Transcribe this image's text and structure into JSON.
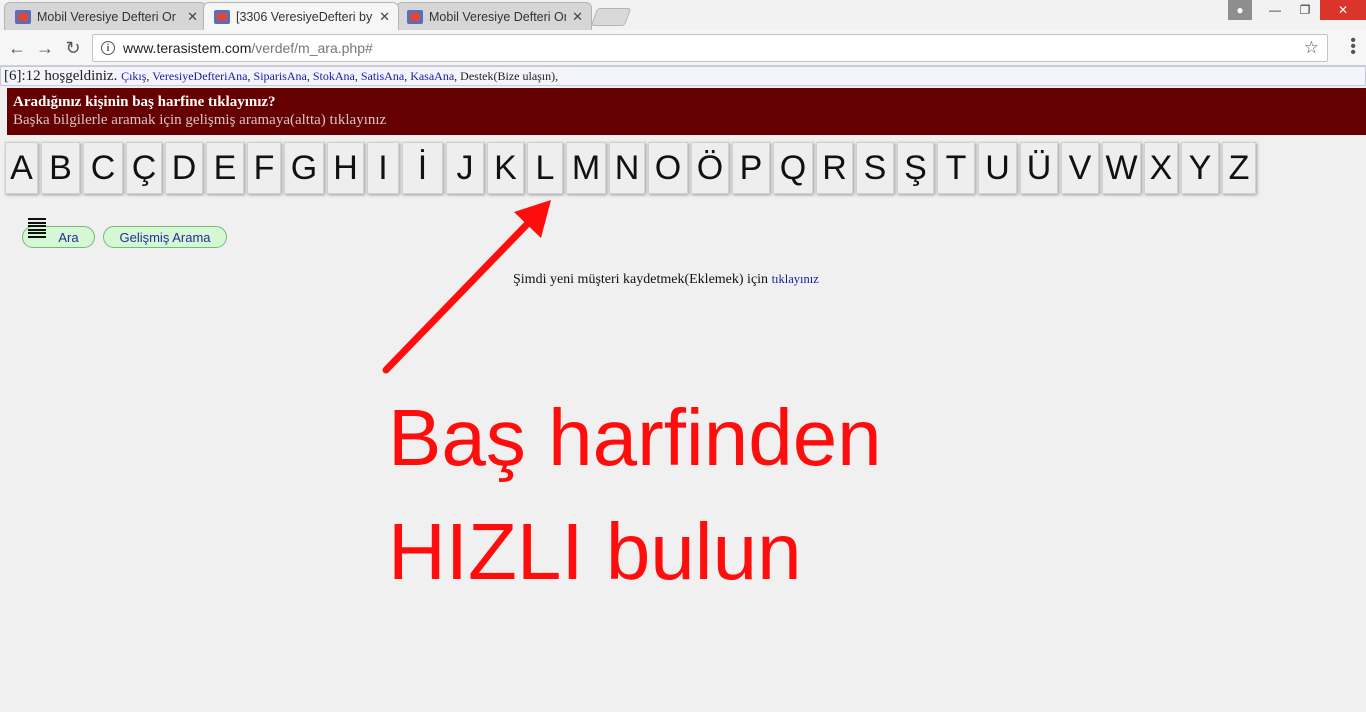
{
  "browser": {
    "tabs": [
      {
        "title": "Mobil Veresiye Defteri Or",
        "active": false
      },
      {
        "title": "[3306 VeresiyeDefteri by",
        "active": true
      },
      {
        "title": "Mobil Veresiye Defteri Or",
        "active": false
      }
    ],
    "tab_close_glyph": "✕",
    "url_host": "www.terasistem.com",
    "url_path": "/verdef/m_ara.php#"
  },
  "welcome": {
    "greeting": "[6]:12 hoşgeldiniz.",
    "links": [
      "Çıkış",
      "VeresiyeDefteriAna",
      "SiparisAna",
      "StokAna",
      "SatisAna",
      "KasaAna",
      "Destek(Bize ulaşın)"
    ],
    "trailing": ","
  },
  "banner": {
    "line1": "Aradığınız kişinin baş harfine tıklayınız?",
    "line2": "Başka bilgilerle aramak için gelişmiş aramaya(altta) tıklayınız"
  },
  "letters": [
    "A",
    "B",
    "C",
    "Ç",
    "D",
    "E",
    "F",
    "G",
    "H",
    "I",
    "İ",
    "J",
    "K",
    "L",
    "M",
    "N",
    "O",
    "Ö",
    "P",
    "Q",
    "R",
    "S",
    "Ş",
    "T",
    "U",
    "Ü",
    "V",
    "W",
    "X",
    "Y",
    "Z"
  ],
  "buttons": {
    "search_label": "Ara",
    "advanced_label": "Gelişmiş Arama"
  },
  "new_customer": {
    "text": "Şimdi yeni müşteri kaydetmek(Eklemek) için",
    "link": "tıklayınız"
  },
  "annotation": {
    "line1": "Baş harfinden",
    "line2": "HIZLI bulun",
    "color": "#ff0d0d"
  },
  "colors": {
    "banner_bg": "#660000",
    "pill_bg": "#d4f7d4",
    "link": "#1a1aa8"
  }
}
